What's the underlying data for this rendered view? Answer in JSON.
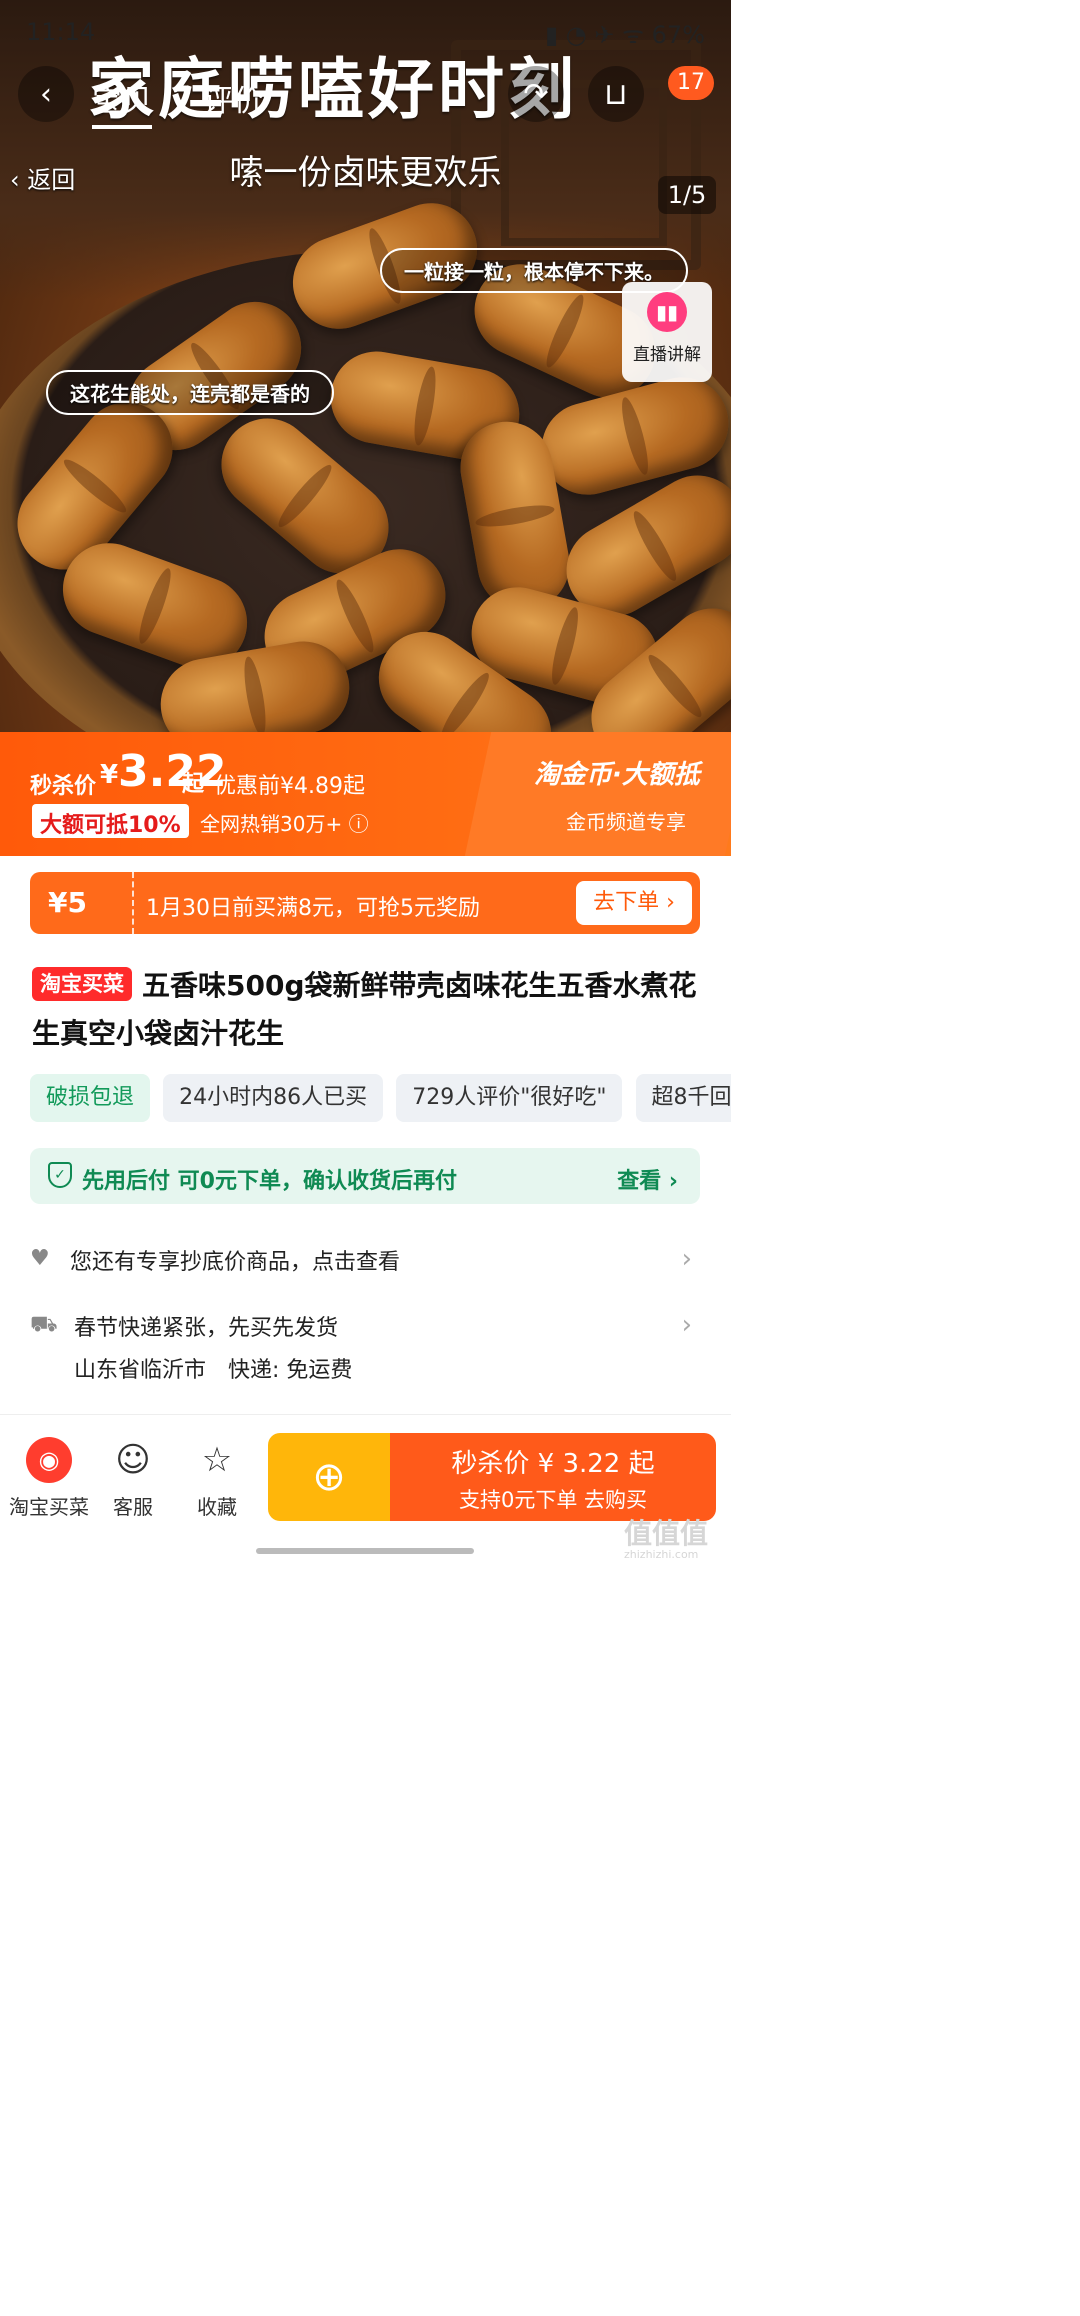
{
  "status_bar": {
    "time": "11:14",
    "battery": "67%"
  },
  "hero": {
    "banner_text": "家庭唠嗑好时刻",
    "tabs": [
      "宝贝",
      "评价"
    ],
    "cart_badge": "17",
    "back_label": "返回",
    "subtitle": "嗦一份卤味更欢乐",
    "page_indicator": "1/5",
    "bubble_1": "一粒接一粒，根本停不下来。",
    "bubble_2": "这花生能处，连壳都是香的",
    "live_label": "直播讲解"
  },
  "price_bar": {
    "flash_label": "秒杀价",
    "currency": "¥",
    "price": "3.22",
    "price_suffix": "起",
    "original": "优惠前¥4.89起",
    "deduct_badge": "大额可抵10%",
    "sales": "全网热销30万+",
    "coin_title": "淘金币·大额抵",
    "coin_sub": "金币频道专享"
  },
  "coupon": {
    "amount": "¥5",
    "text": "1月30日前买满8元，可抢5元奖励",
    "button": "去下单 ›"
  },
  "title": {
    "tag": "淘宝买菜",
    "text": "五香味500g袋新鲜带壳卤味花生五香水煮花生真空小袋卤汁花生"
  },
  "chips": [
    "破损包退",
    "24小时内86人已买",
    "729人评价\"很好吃\"",
    "超8千回"
  ],
  "paylater": {
    "text": "先用后付 可0元下单，确认收货后再付",
    "link": "查看 ›"
  },
  "info": {
    "exclusive": "您还有专享抄底价商品，点击查看",
    "shipping_notice": "春节快递紧张，先买先发货",
    "shipping_from": "山东省临沂市",
    "shipping_fee": "快递: 免运费"
  },
  "bottom_bar": {
    "tabs": [
      "淘宝买菜",
      "客服",
      "收藏"
    ],
    "buy_main": "秒杀价 ¥ 3.22 起",
    "buy_sub": "支持0元下单  去购买"
  },
  "watermark": {
    "main": "值值值",
    "sub": "zhizhizhi.com"
  }
}
